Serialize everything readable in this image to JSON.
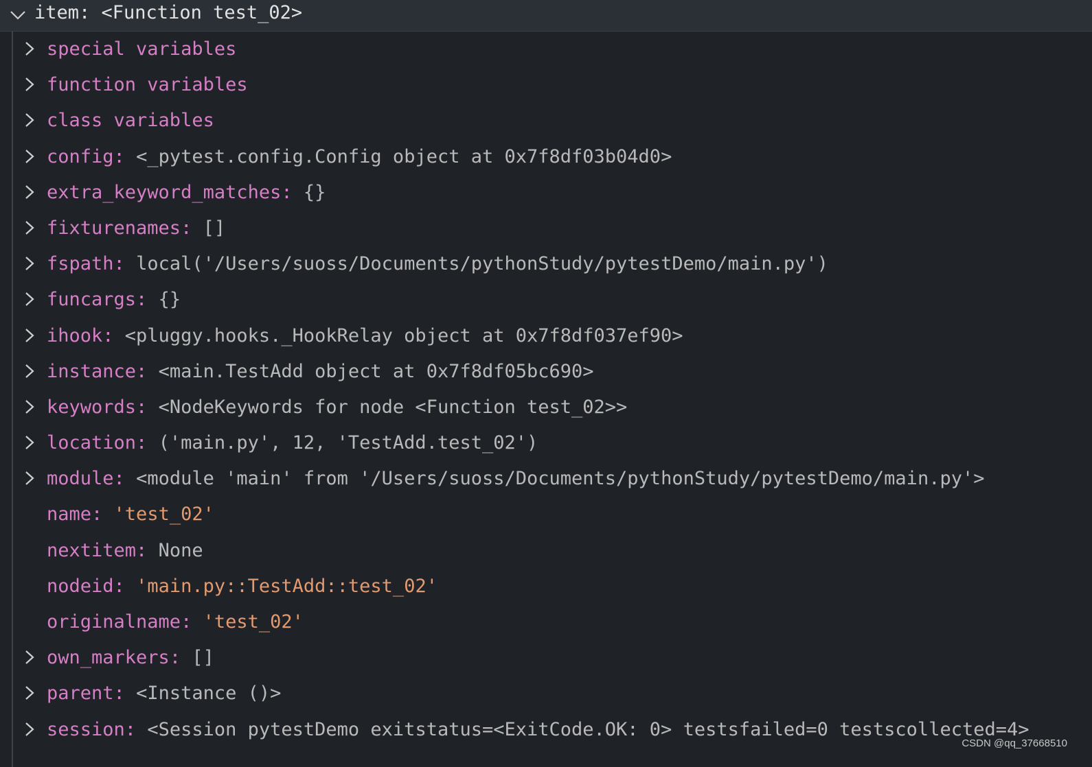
{
  "header": {
    "label": "item: <Function test_02>"
  },
  "rows": [
    {
      "key": "special variables",
      "sep": "",
      "value": "",
      "type": "group",
      "expandable": true
    },
    {
      "key": "function variables",
      "sep": "",
      "value": "",
      "type": "group",
      "expandable": true
    },
    {
      "key": "class variables",
      "sep": "",
      "value": "",
      "type": "group",
      "expandable": true
    },
    {
      "key": "config",
      "sep": ": ",
      "value": "<_pytest.config.Config object at 0x7f8df03b04d0>",
      "type": "obj",
      "expandable": true
    },
    {
      "key": "extra_keyword_matches",
      "sep": ": ",
      "value": "{}",
      "type": "obj",
      "expandable": true
    },
    {
      "key": "fixturenames",
      "sep": ": ",
      "value": "[]",
      "type": "obj",
      "expandable": true
    },
    {
      "key": "fspath",
      "sep": ": ",
      "value": "local('/Users/suoss/Documents/pythonStudy/pytestDemo/main.py')",
      "type": "obj",
      "expandable": true
    },
    {
      "key": "funcargs",
      "sep": ": ",
      "value": "{}",
      "type": "obj",
      "expandable": true
    },
    {
      "key": "ihook",
      "sep": ": ",
      "value": "<pluggy.hooks._HookRelay object at 0x7f8df037ef90>",
      "type": "obj",
      "expandable": true
    },
    {
      "key": "instance",
      "sep": ": ",
      "value": "<main.TestAdd object at 0x7f8df05bc690>",
      "type": "obj",
      "expandable": true
    },
    {
      "key": "keywords",
      "sep": ": ",
      "value": "<NodeKeywords for node <Function test_02>>",
      "type": "obj",
      "expandable": true
    },
    {
      "key": "location",
      "sep": ": ",
      "value": "('main.py', 12, 'TestAdd.test_02')",
      "type": "obj",
      "expandable": true
    },
    {
      "key": "module",
      "sep": ": ",
      "value": "<module 'main' from '/Users/suoss/Documents/pythonStudy/pytestDemo/main.py'>",
      "type": "obj",
      "expandable": true
    },
    {
      "key": "name",
      "sep": ": ",
      "value": "'test_02'",
      "type": "str",
      "expandable": false
    },
    {
      "key": "nextitem",
      "sep": ": ",
      "value": "None",
      "type": "obj",
      "expandable": false
    },
    {
      "key": "nodeid",
      "sep": ": ",
      "value": "'main.py::TestAdd::test_02'",
      "type": "str",
      "expandable": false
    },
    {
      "key": "originalname",
      "sep": ": ",
      "value": "'test_02'",
      "type": "str",
      "expandable": false
    },
    {
      "key": "own_markers",
      "sep": ": ",
      "value": "[]",
      "type": "obj",
      "expandable": true
    },
    {
      "key": "parent",
      "sep": ": ",
      "value": "<Instance ()>",
      "type": "obj",
      "expandable": true
    },
    {
      "key": "session",
      "sep": ": ",
      "value": "<Session pytestDemo exitstatus=<ExitCode.OK: 0> testsfailed=0 testscollected=4>",
      "type": "obj",
      "expandable": true
    }
  ],
  "watermark": "CSDN @qq_37668510",
  "colors": {
    "key": "#d67fc6",
    "value": "#b9b9b9",
    "string": "#e29a6e",
    "background": "#1f2227",
    "header_background": "#2b2f36"
  },
  "icons": {
    "collapsed": "chevron-right-icon",
    "expanded": "chevron-down-icon"
  }
}
